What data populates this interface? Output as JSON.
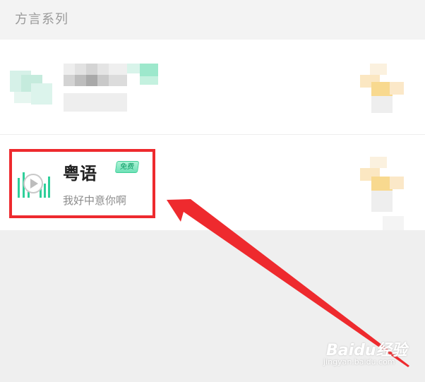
{
  "section": {
    "title": "方言系列"
  },
  "items": [
    {
      "title": "",
      "subtitle": "",
      "blurred": true
    },
    {
      "title": "粤语",
      "badge": "免费",
      "subtitle": "我好中意你啊",
      "blurred": false
    }
  ],
  "icons": {
    "play": "play-icon",
    "sound_wave": "sound-wave-icon",
    "download": "download-icon"
  },
  "colors": {
    "accent": "#2fcf9a",
    "highlight": "#ee2a2e",
    "placeholder_orange": "#f8d98f"
  },
  "watermark": {
    "main": "Baidu经验",
    "sub": "jingyan.baidu.com"
  }
}
